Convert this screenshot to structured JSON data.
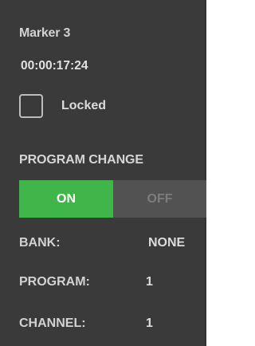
{
  "marker": {
    "name": "Marker 3",
    "timecode": "00:00:17:24"
  },
  "locked": {
    "label": "Locked",
    "checked": false
  },
  "program_change": {
    "title": "PROGRAM CHANGE",
    "on_label": "ON",
    "off_label": "OFF",
    "state": "ON",
    "on_color": "#3fb54a",
    "off_color": "#525252"
  },
  "fields": {
    "bank": {
      "label": "BANK:",
      "value": "NONE"
    },
    "program": {
      "label": "PROGRAM:",
      "value": "1"
    },
    "channel": {
      "label": "CHANNEL:",
      "value": "1"
    }
  },
  "colors": {
    "panel_background": "#3a3a3a",
    "text": "#d2d2d2"
  }
}
